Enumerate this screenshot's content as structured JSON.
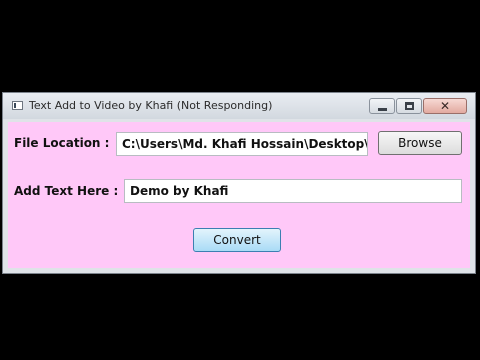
{
  "window": {
    "title": "Text Add to Video by Khafi (Not Responding)",
    "close_glyph": "✕"
  },
  "form": {
    "file_location_label": "File Location :",
    "file_location_value": "C:\\Users\\Md. Khafi Hossain\\Desktop\\Py",
    "browse_label": "Browse",
    "add_text_label": "Add Text Here :",
    "add_text_value": "Demo by Khafi",
    "convert_label": "Convert"
  },
  "colors": {
    "client_background": "#ffc8f8",
    "outer_background": "#000000"
  },
  "icons": {
    "app": "app-window-icon",
    "minimize": "minimize-icon",
    "maximize": "maximize-icon",
    "close": "close-icon"
  }
}
